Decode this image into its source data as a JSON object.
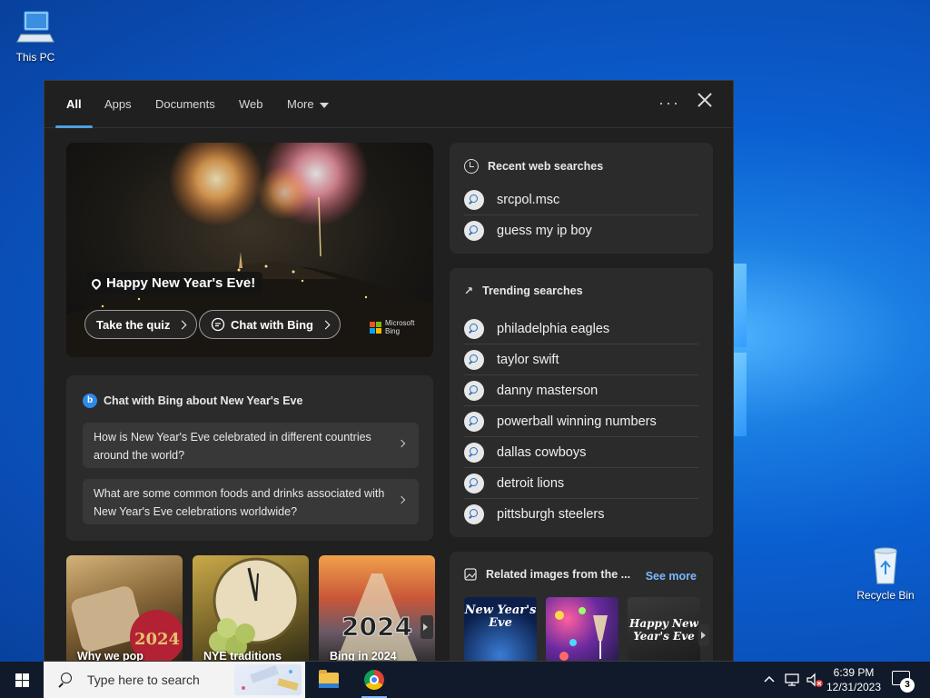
{
  "desktop": {
    "icons": [
      {
        "label": "This PC",
        "icon": "this-pc-icon"
      },
      {
        "label": "Recycle Bin",
        "icon": "recycle-bin-icon"
      }
    ]
  },
  "search_panel": {
    "tabs": [
      {
        "label": "All",
        "active": true
      },
      {
        "label": "Apps"
      },
      {
        "label": "Documents"
      },
      {
        "label": "Web"
      },
      {
        "label": "More"
      }
    ],
    "more_options_label": "···",
    "hero": {
      "title": "Happy New Year's Eve!",
      "quiz_button": "Take the quiz",
      "chat_button": "Chat with Bing",
      "brand_line1": "Microsoft",
      "brand_line2": "Bing"
    },
    "chat_card": {
      "title": "Chat with Bing about New Year's Eve",
      "questions": [
        "How is New Year's Eve celebrated in different countries around the world?",
        "What are some common foods and drinks associated with New Year's Eve celebrations worldwide?"
      ]
    },
    "tiles": [
      {
        "label": "Why we pop"
      },
      {
        "label": "NYE traditions"
      },
      {
        "label": "Bing in 2024"
      }
    ],
    "recent": {
      "title": "Recent web searches",
      "items": [
        "srcpol.msc",
        "guess my ip boy"
      ]
    },
    "trending": {
      "title": "Trending searches",
      "items": [
        "philadelphia eagles",
        "taylor swift",
        "danny masterson",
        "powerball winning numbers",
        "dallas cowboys",
        "detroit lions",
        "pittsburgh steelers"
      ]
    },
    "related": {
      "title": "Related images from the ...",
      "see_more": "See more",
      "images": [
        {
          "caption": "New Year's Eve"
        },
        {
          "caption": ""
        },
        {
          "caption": "Happy New Year's Eve"
        }
      ]
    }
  },
  "taskbar": {
    "search_placeholder": "Type here to search",
    "time": "6:39 PM",
    "date": "12/31/2023",
    "notification_count": "3"
  },
  "colors": {
    "accent": "#4ca0e0",
    "link": "#7ab8ff",
    "panel_bg": "#202020",
    "card_bg": "#2b2b2b"
  }
}
